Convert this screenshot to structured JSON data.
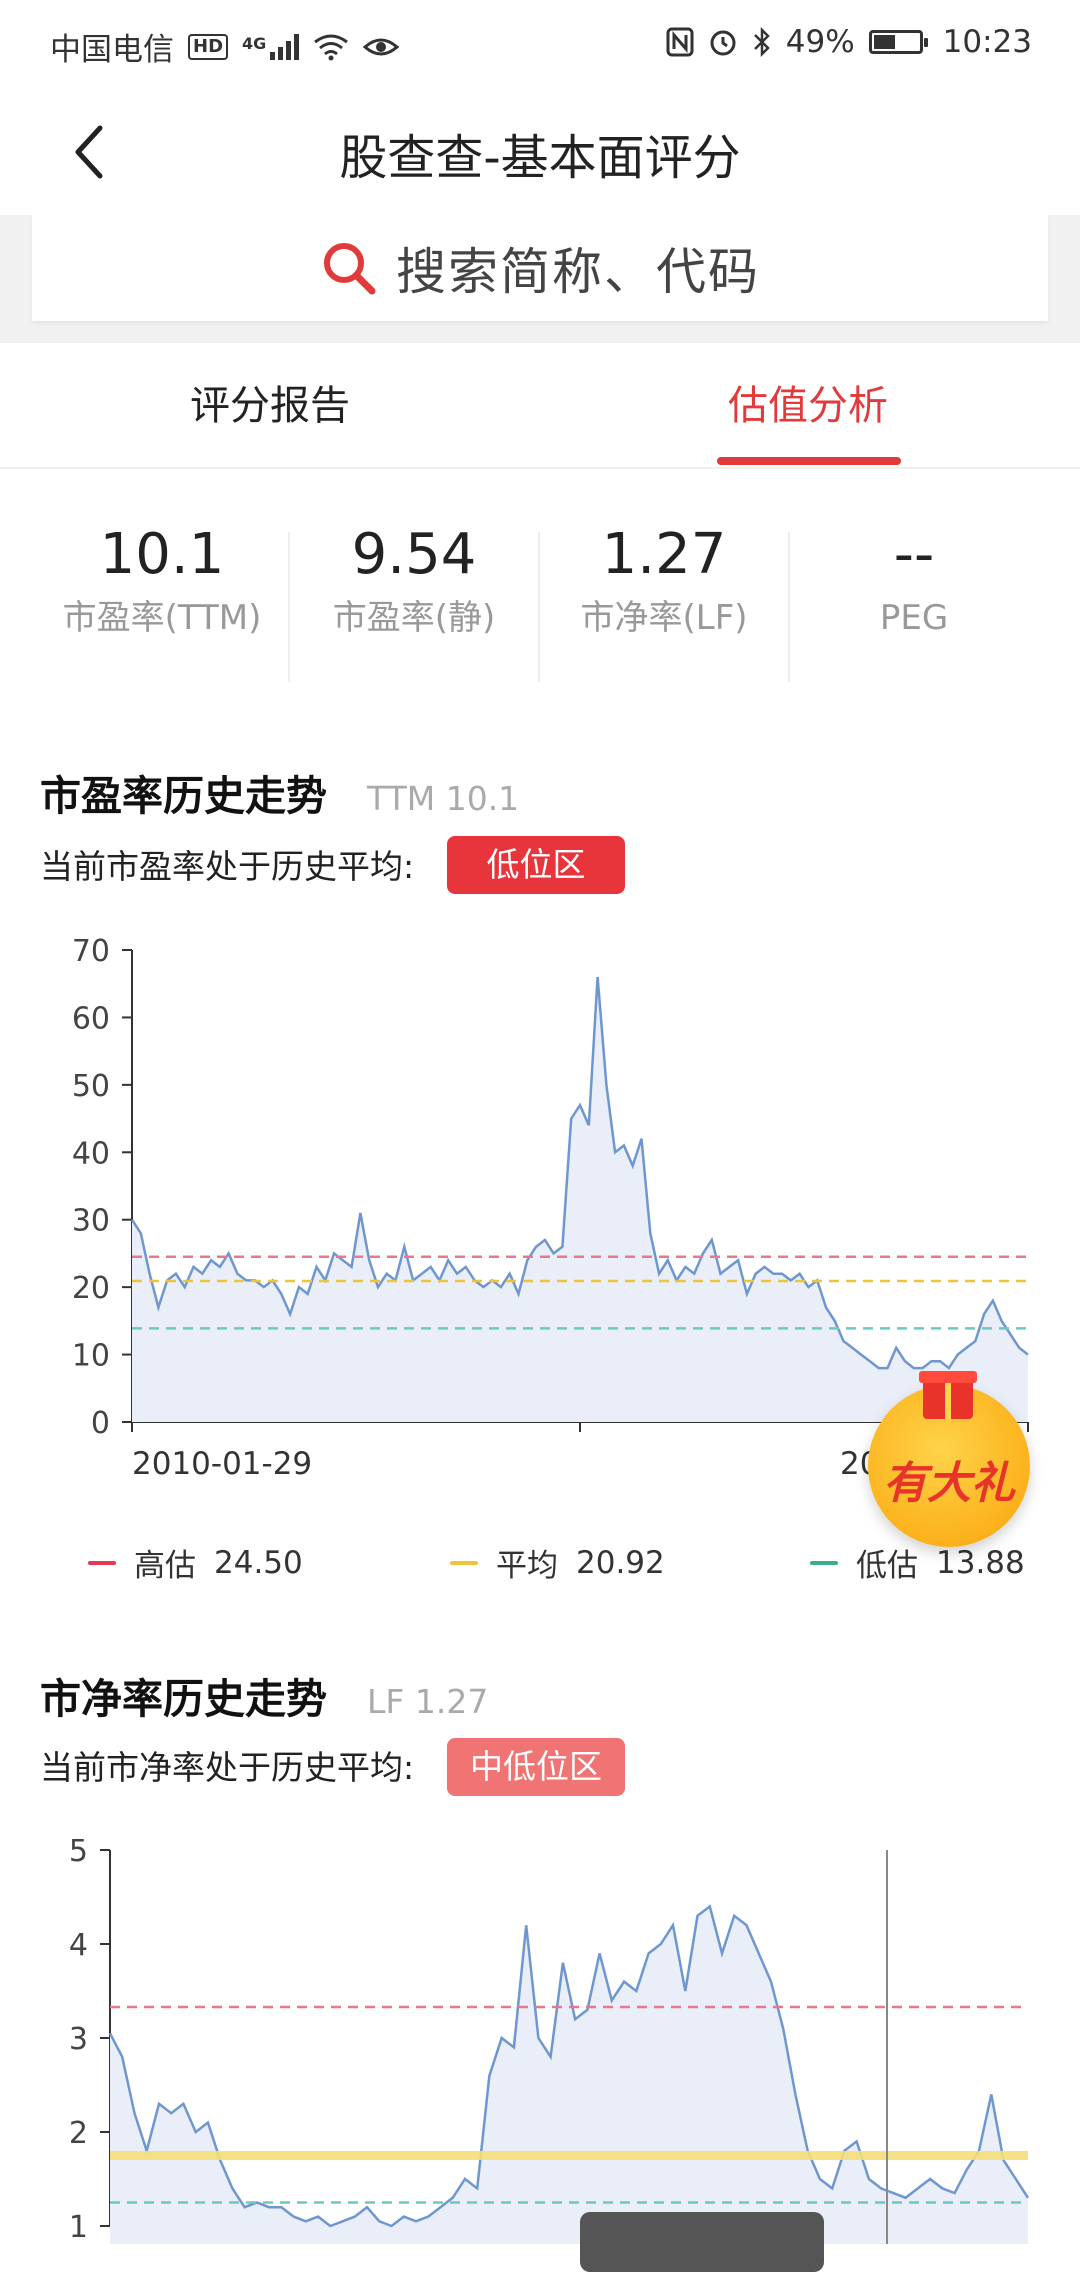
{
  "status_bar": {
    "carrier": "中国电信",
    "hd": "HD",
    "network": "4G",
    "battery": "49%",
    "battery_level": 0.49,
    "time": "10:23",
    "icons": [
      "signal-icon",
      "wifi-icon",
      "eye-icon",
      "nfc-icon",
      "alarm-icon",
      "bluetooth-icon",
      "battery-icon"
    ]
  },
  "header": {
    "title": "股查查-基本面评分",
    "back_icon": "chevron-left-icon"
  },
  "search": {
    "placeholder": "搜索简称、代码",
    "icon": "search-icon"
  },
  "tabs": [
    {
      "label": "评分报告",
      "active": false
    },
    {
      "label": "估值分析",
      "active": true
    }
  ],
  "metrics": [
    {
      "value": "10.1",
      "label": "市盈率(TTM)"
    },
    {
      "value": "9.54",
      "label": "市盈率(静)"
    },
    {
      "value": "1.27",
      "label": "市净率(LF)"
    },
    {
      "value": "--",
      "label": "PEG"
    }
  ],
  "pe_section": {
    "title": "市盈率历史走势",
    "subtitle": "TTM 10.1",
    "desc": "当前市盈率处于历史平均:",
    "badge": "低位区",
    "badge_color": "#e8353b"
  },
  "pb_section": {
    "title": "市净率历史走势",
    "subtitle": "LF 1.27",
    "desc": "当前市净率处于历史平均:",
    "badge": "中低位区",
    "badge_color": "#f07474"
  },
  "legend": [
    {
      "name": "高估",
      "value": "24.50",
      "color": "#e23a55"
    },
    {
      "name": "平均",
      "value": "20.92",
      "color": "#f0c43a"
    },
    {
      "name": "低估",
      "value": "13.88",
      "color": "#3aae8e"
    }
  ],
  "gift": {
    "label": "有大礼",
    "icon": "gift-box-icon"
  },
  "chart_data": [
    {
      "type": "area",
      "ylim": [
        0,
        70
      ],
      "yticks": [
        "0",
        "10",
        "20",
        "30",
        "40",
        "50",
        "60",
        "70"
      ],
      "x_labels": [
        "2010-01-29",
        "20"
      ],
      "reference_lines": [
        {
          "name": "高估",
          "value": 24.5,
          "color": "#e8798a"
        },
        {
          "name": "平均",
          "value": 20.92,
          "color": "#f0c43a"
        },
        {
          "name": "低估",
          "value": 13.88,
          "color": "#6ac9c0"
        }
      ],
      "series": [
        {
          "values": [
            30,
            28,
            22,
            17,
            21,
            22,
            20,
            23,
            22,
            24,
            23,
            25,
            22,
            21,
            21,
            20,
            21,
            19,
            16,
            20,
            19,
            23,
            21,
            25,
            24,
            23,
            31,
            24,
            20,
            22,
            21,
            26,
            21,
            22,
            23,
            21,
            24,
            22,
            23,
            21,
            20,
            21,
            20,
            22,
            19,
            24,
            26,
            27,
            25,
            26,
            45,
            47,
            44,
            66,
            50,
            40,
            41,
            38,
            42,
            28,
            22,
            24,
            21,
            23,
            22,
            25,
            27,
            22,
            23,
            24,
            19,
            22,
            23,
            22,
            22,
            21,
            22,
            20,
            21,
            17,
            15,
            12,
            11,
            10,
            9,
            8,
            8,
            11,
            9,
            8,
            8,
            9,
            9,
            8,
            10,
            11,
            12,
            16,
            18,
            15,
            13,
            11,
            10
          ]
        }
      ]
    },
    {
      "type": "area",
      "ylim": [
        1,
        5
      ],
      "yticks": [
        "1",
        "2",
        "3",
        "4",
        "5"
      ],
      "reference_lines": [
        {
          "name": "高估",
          "value": 3.33,
          "color": "#e8798a"
        },
        {
          "name": "平均",
          "value": 1.75,
          "color": "#f6df7a"
        },
        {
          "name": "低估",
          "value": 1.25,
          "color": "#6ac9c0"
        }
      ],
      "series": [
        {
          "values": [
            3.05,
            2.8,
            2.2,
            1.8,
            2.3,
            2.2,
            2.3,
            2.0,
            2.1,
            1.7,
            1.4,
            1.2,
            1.25,
            1.2,
            1.2,
            1.1,
            1.05,
            1.1,
            1.0,
            1.05,
            1.1,
            1.2,
            1.05,
            1.0,
            1.1,
            1.05,
            1.1,
            1.2,
            1.3,
            1.5,
            1.4,
            2.6,
            3.0,
            2.9,
            4.2,
            3.0,
            2.8,
            3.8,
            3.2,
            3.3,
            3.9,
            3.4,
            3.6,
            3.5,
            3.9,
            4.0,
            4.2,
            3.5,
            4.3,
            4.4,
            3.9,
            4.3,
            4.2,
            3.9,
            3.6,
            3.1,
            2.4,
            1.8,
            1.5,
            1.4,
            1.8,
            1.9,
            1.5,
            1.4,
            1.35,
            1.3,
            1.4,
            1.5,
            1.4,
            1.35,
            1.6,
            1.8,
            2.4,
            1.7,
            1.5,
            1.3
          ]
        }
      ]
    }
  ]
}
